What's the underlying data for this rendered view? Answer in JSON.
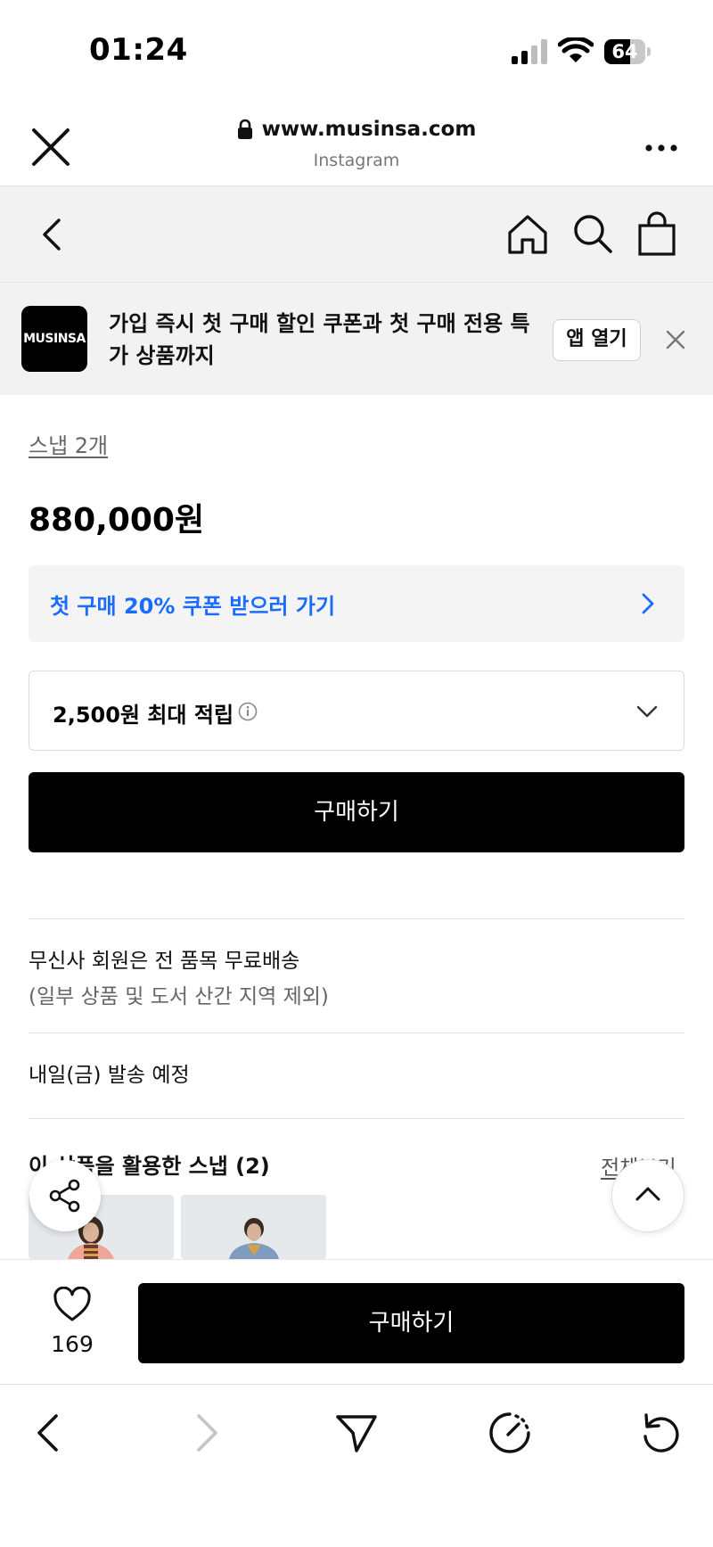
{
  "status_bar": {
    "time": "01:24",
    "battery": "64",
    "battery_level": 0.64
  },
  "browser": {
    "url": "www.musinsa.com",
    "source": "Instagram"
  },
  "app_banner": {
    "logo": "MUSINSA",
    "text": "가입 즉시 첫 구매 할인 쿠폰과 첫 구매 전용 특가 상품까지",
    "open_button": "앱 열기"
  },
  "product": {
    "snap_link": "스냅 2개",
    "price": "880,000원",
    "coupon_text": "첫 구매 20% 쿠폰 받으러 가기",
    "points_text": "2,500원 최대 적립",
    "buy_label": "구매하기"
  },
  "shipping": {
    "main": "무신사 회원은 전 품목 무료배송",
    "sub": "(일부 상품 및 도서 산간 지역 제외)",
    "dispatch": "내일(금) 발송 예정"
  },
  "snaps": {
    "title": "이 상품을 활용한 스냅 (2)",
    "view_all": "전체보기"
  },
  "purchase_bar": {
    "like_count": "169",
    "buy_label": "구매하기"
  },
  "colors": {
    "accent_blue": "#1a6bff",
    "primary_button": "#000000",
    "nav_background": "#f2f2f2"
  }
}
